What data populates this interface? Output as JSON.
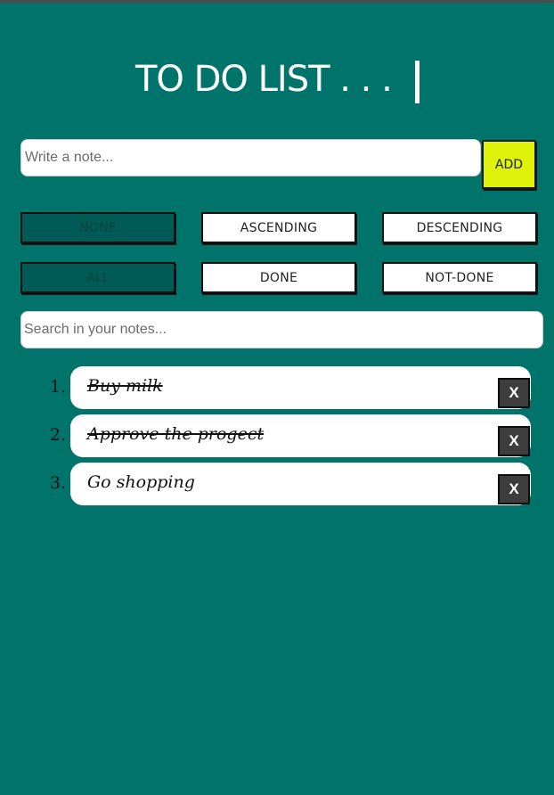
{
  "header": {
    "title": "TO DO LIST . . ."
  },
  "note_form": {
    "placeholder": "Write a note...",
    "add_label": "ADD",
    "add_color": "#e1f20a"
  },
  "sort_options": [
    {
      "label": "NONE",
      "active": true
    },
    {
      "label": "ASCENDING",
      "active": false
    },
    {
      "label": "DESCENDING",
      "active": false
    }
  ],
  "filter_options": [
    {
      "label": "ALL",
      "active": true
    },
    {
      "label": "DONE",
      "active": false
    },
    {
      "label": "NOT-DONE",
      "active": false
    }
  ],
  "search": {
    "placeholder": "Search in your notes..."
  },
  "todos": [
    {
      "number": "1.",
      "text": "Buy milk",
      "done": true,
      "delete_label": "X"
    },
    {
      "number": "2.",
      "text": "Approve the progect",
      "done": true,
      "delete_label": "X"
    },
    {
      "number": "3.",
      "text": "Go shopping",
      "done": false,
      "delete_label": "X"
    }
  ],
  "colors": {
    "background": "#00746a",
    "active_chip": "#005a55",
    "delete_button": "#3d3d3d"
  }
}
